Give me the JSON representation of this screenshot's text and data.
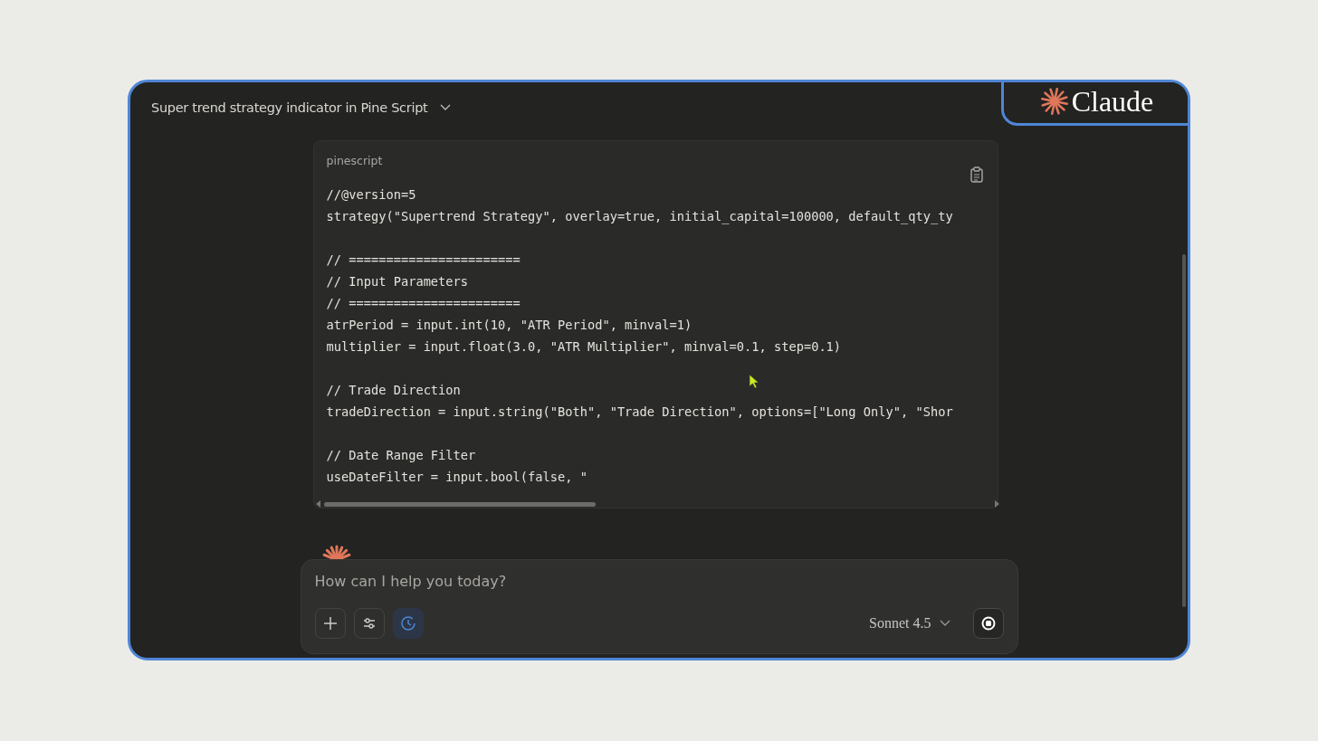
{
  "header": {
    "title": "Super trend strategy indicator in Pine Script",
    "logo_text": "Claude"
  },
  "code_block": {
    "language": "pinescript",
    "blocks": [
      [
        "//@version=5",
        "strategy(\"Supertrend Strategy\", overlay=true, initial_capital=100000, default_qty_ty"
      ],
      [
        "// =======================",
        "// Input Parameters",
        "// =======================",
        "atrPeriod = input.int(10, \"ATR Period\", minval=1)",
        "multiplier = input.float(3.0, \"ATR Multiplier\", minval=0.1, step=0.1)"
      ],
      [
        "// Trade Direction",
        "tradeDirection = input.string(\"Both\", \"Trade Direction\", options=[\"Long Only\", \"Shor"
      ],
      [
        "// Date Range Filter",
        "useDateFilter = input.bool(false, \""
      ]
    ]
  },
  "composer": {
    "placeholder": "How can I help you today?",
    "model": "Sonnet 4.5",
    "tools": [
      {
        "kind": "plus",
        "selected": false
      },
      {
        "kind": "sliders",
        "selected": false
      },
      {
        "kind": "clock",
        "selected": true
      }
    ]
  }
}
